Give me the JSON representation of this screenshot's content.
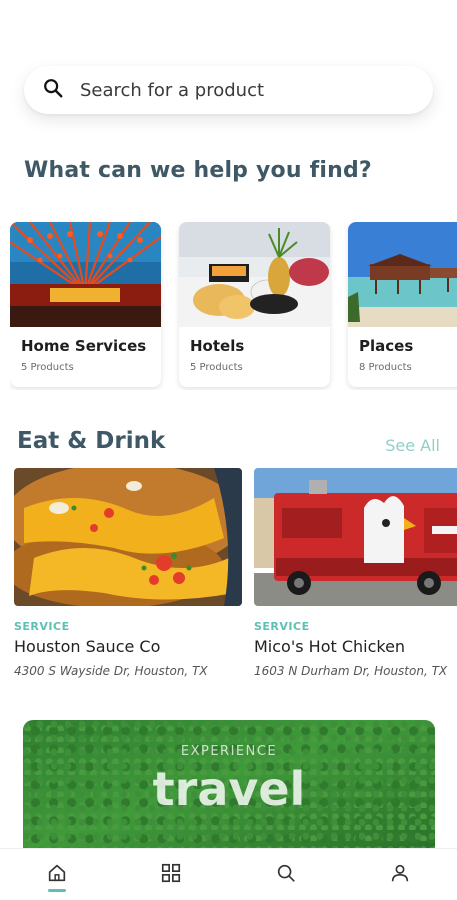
{
  "search": {
    "placeholder": "Search for a product",
    "icon": "search-icon"
  },
  "heading": "What can we help you find?",
  "categories": [
    {
      "title": "Home Services",
      "subtitle": "5 Products"
    },
    {
      "title": "Hotels",
      "subtitle": "5 Products"
    },
    {
      "title": "Places",
      "subtitle": "8 Products"
    }
  ],
  "eat_drink": {
    "title": "Eat & Drink",
    "see_all": "See All",
    "items": [
      {
        "type": "SERVICE",
        "name": "Houston Sauce Co",
        "address": "4300 S Wayside Dr, Houston, TX"
      },
      {
        "type": "SERVICE",
        "name": "Mico's Hot Chicken",
        "address": "1603 N Durham Dr, Houston, TX"
      }
    ]
  },
  "banner": {
    "eyebrow": "EXPERIENCE",
    "title": "travel"
  },
  "tabbar": {
    "items": [
      "home-icon",
      "grid-icon",
      "search-icon",
      "user-icon"
    ],
    "active": "home-icon"
  },
  "colors": {
    "accent": "#5cc1b4",
    "heading": "#3f5866"
  }
}
